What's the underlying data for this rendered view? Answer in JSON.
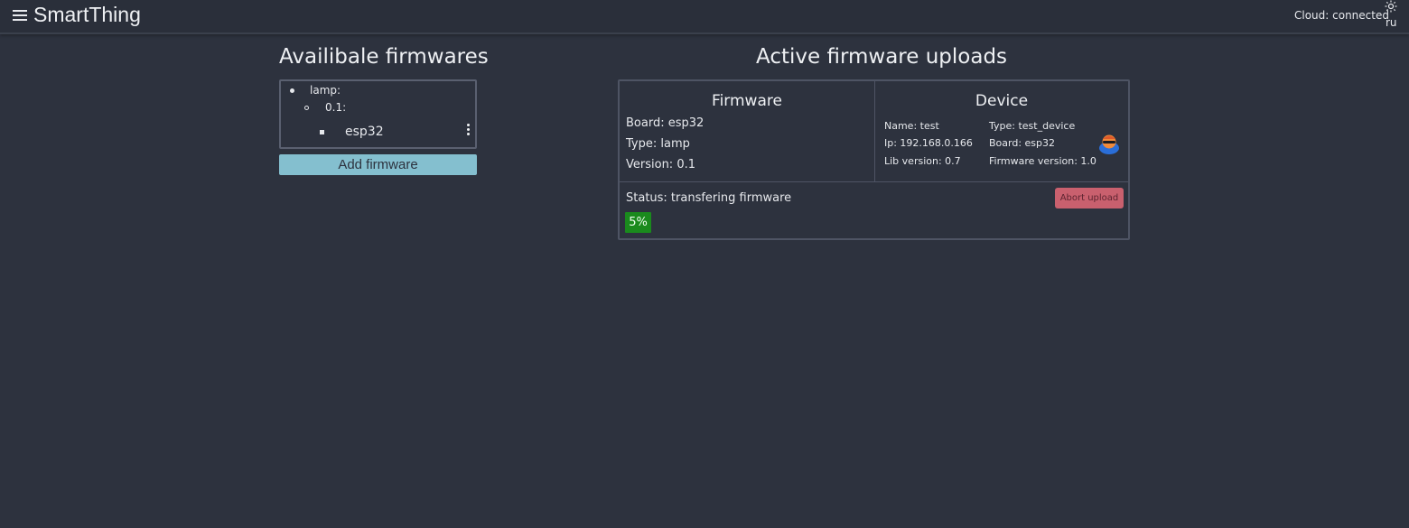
{
  "header": {
    "title": "SmartThing",
    "cloud_status": "Cloud: connected",
    "language": "ru"
  },
  "left_panel": {
    "title": "Availibale firmwares",
    "tree": {
      "type_label": "lamp:",
      "version_label": "0.1:",
      "board_label": "esp32"
    },
    "add_button_label": "Add firmware"
  },
  "right_panel": {
    "title": "Active firmware uploads",
    "firmware": {
      "heading": "Firmware",
      "board": "Board: esp32",
      "type": "Type: lamp",
      "version": "Version: 0.1"
    },
    "device": {
      "heading": "Device",
      "name": "Name: test",
      "ip": "Ip: 192.168.0.166",
      "lib_version": "Lib version: 0.7",
      "type": "Type: test_device",
      "board": "Board: esp32",
      "firmware_version": "Firmware version: 1.0"
    },
    "status": "Status: transfering firmware",
    "abort_label": "Abort upload",
    "progress_label": "5%",
    "progress_percent": 5
  },
  "colors": {
    "background": "#2d323e",
    "accent_button": "#84bfcf",
    "abort_button": "#c9606e",
    "progress": "#1a8a1d"
  }
}
